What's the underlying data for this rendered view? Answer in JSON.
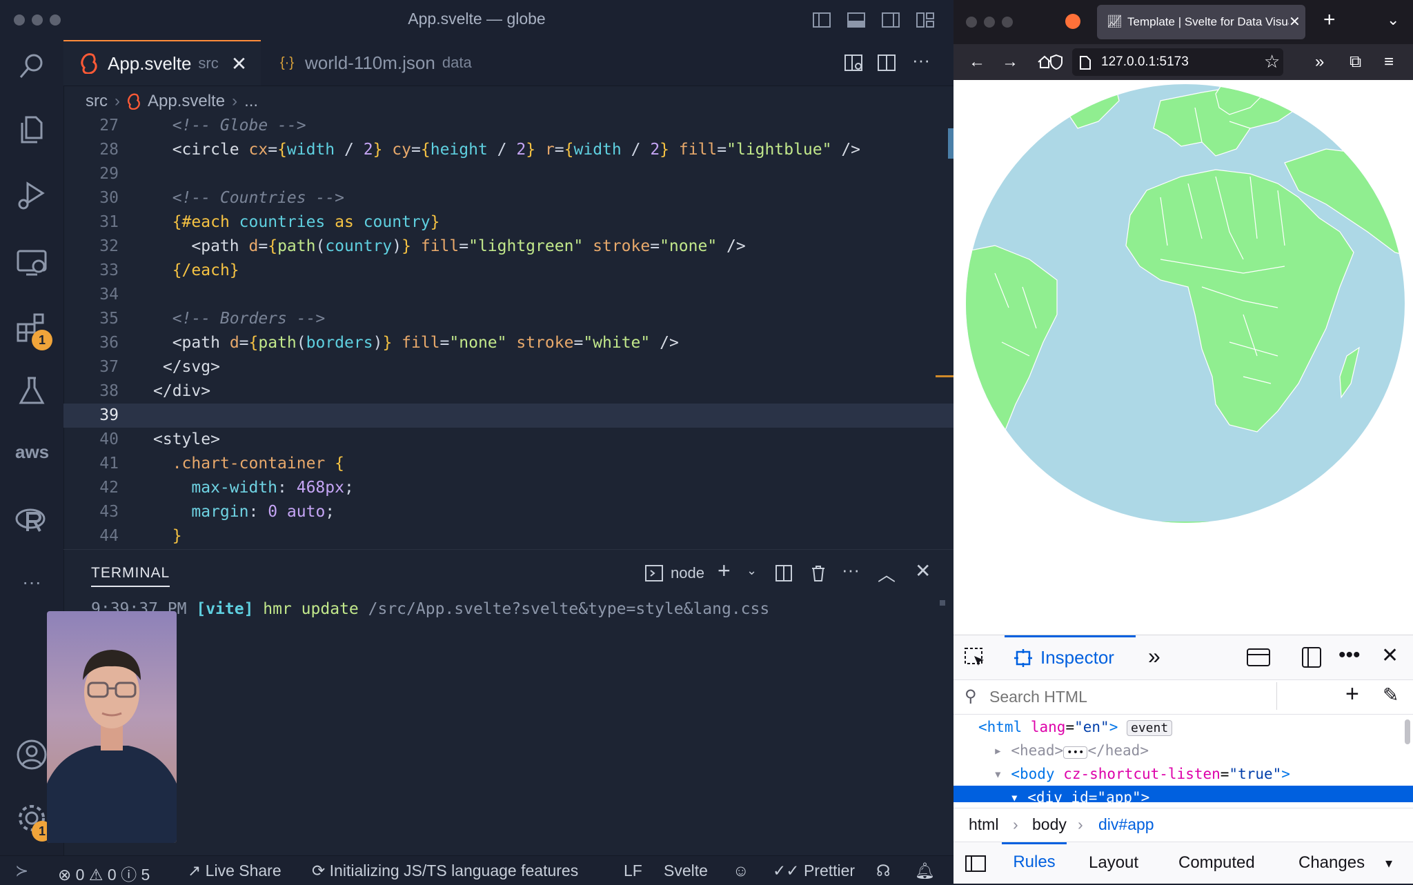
{
  "vscode": {
    "window_title": "App.svelte — globe",
    "tabs": [
      {
        "name": "App.svelte",
        "sub": "src"
      },
      {
        "name": "world-110m.json",
        "sub": "data"
      }
    ],
    "breadcrumb": [
      "src",
      "App.svelte",
      "..."
    ],
    "activity_badges": {
      "extensions": "1",
      "settings": "1"
    },
    "activity_aws": "aws",
    "activity_more": "···",
    "code_line_numbers": [
      "27",
      "28",
      "29",
      "30",
      "31",
      "32",
      "33",
      "34",
      "35",
      "36",
      "37",
      "38",
      "39",
      "40",
      "41",
      "42",
      "43",
      "44"
    ],
    "current_line": "39",
    "terminal": {
      "tab_label": "TERMINAL",
      "shell": "node",
      "log_time": "9:39:37 PM",
      "log_tag": "[vite]",
      "log_text": "hmr update",
      "log_path": "/src/App.svelte?svelte&type=style&lang.css"
    },
    "statusbar": {
      "errors": "0",
      "warnings": "0",
      "info": "5",
      "live_share": "Live Share",
      "language_status": "Initializing JS/TS language features",
      "eol": "LF",
      "language": "Svelte",
      "formatter": "Prettier"
    }
  },
  "firefox": {
    "tab_title": "Template | Svelte for Data Visual",
    "url": "127.0.0.1:5173",
    "devtools": {
      "active_tool": "Inspector",
      "search_placeholder": "Search HTML",
      "event_badge": "event",
      "breadcrumbs": [
        "html",
        "body",
        "div#app"
      ],
      "subtabs": [
        "Rules",
        "Layout",
        "Computed",
        "Changes"
      ]
    }
  },
  "colors": {
    "ocean": "#add8e6",
    "land": "#90ee90",
    "accent_orange": "#ff8c3a",
    "selection_blue": "#0060df"
  }
}
